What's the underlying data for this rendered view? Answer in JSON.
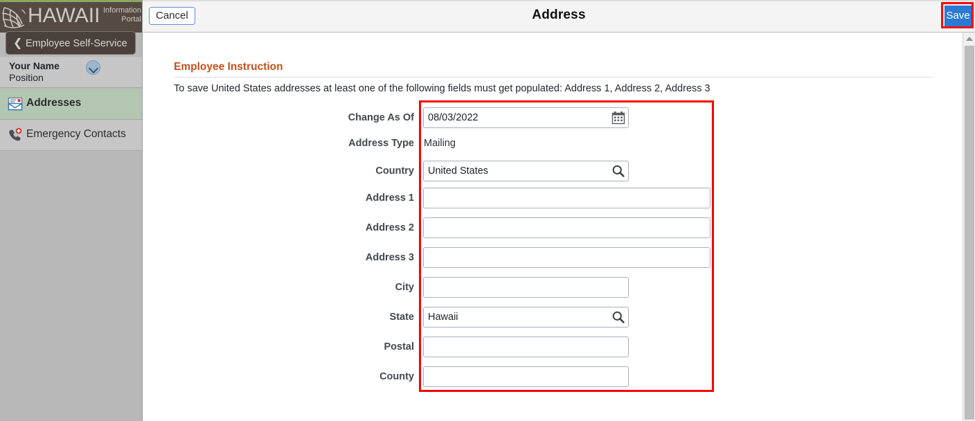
{
  "brand": {
    "name": "HAWAII",
    "sub_line1": "Information",
    "sub_line2": "Portal",
    "logo_icon": "hawaii-net-logo-icon"
  },
  "sidebar": {
    "back_pill": {
      "label": "Employee Self-Service",
      "icon": "chevron-left-icon"
    },
    "user": {
      "name": "Your Name",
      "position": "Position",
      "expand_icon": "chevron-down-circle-icon"
    },
    "items": [
      {
        "label": "Addresses",
        "icon": "address-envelope-icon",
        "selected": true
      },
      {
        "label": "Emergency Contacts",
        "icon": "phone-emergency-icon",
        "selected": false
      }
    ]
  },
  "header": {
    "cancel_label": "Cancel",
    "title": "Address",
    "save_label": "Save",
    "save_highlight_color": "#ff0000",
    "save_button_color": "#2a7ad4"
  },
  "instruction": {
    "heading": "Employee Instruction",
    "heading_color": "#c2521c",
    "text": "To save United States addresses at least one of the following fields must get populated: Address 1, Address 2, Address 3"
  },
  "form": {
    "highlight_color": "#ff0000",
    "fields": [
      {
        "label": "Change As Of",
        "value": "08/03/2022",
        "placeholder": "",
        "type": "input",
        "width": "narrow",
        "adorn": "calendar-icon"
      },
      {
        "label": "Address Type",
        "value": "Mailing",
        "type": "static"
      },
      {
        "label": "Country",
        "value": "United States",
        "placeholder": "",
        "type": "input",
        "width": "narrow",
        "adorn": "search-icon"
      },
      {
        "label": "Address 1",
        "value": "",
        "placeholder": "",
        "type": "input",
        "width": "wide",
        "adorn": ""
      },
      {
        "label": "Address 2",
        "value": "",
        "placeholder": "",
        "type": "input",
        "width": "wide",
        "adorn": ""
      },
      {
        "label": "Address 3",
        "value": "",
        "placeholder": "",
        "type": "input",
        "width": "wide",
        "adorn": ""
      },
      {
        "label": "City",
        "value": "",
        "placeholder": "",
        "type": "input",
        "width": "narrow",
        "adorn": ""
      },
      {
        "label": "State",
        "value": "Hawaii",
        "placeholder": "",
        "type": "input",
        "width": "narrow",
        "adorn": "search-icon"
      },
      {
        "label": "Postal",
        "value": "",
        "placeholder": "",
        "type": "input",
        "width": "narrow",
        "adorn": ""
      },
      {
        "label": "County",
        "value": "",
        "placeholder": "",
        "type": "input",
        "width": "narrow",
        "adorn": ""
      }
    ]
  },
  "scrollbar": {
    "up_arrow_icon": "scroll-up-arrow-icon",
    "thumb": "scroll-thumb"
  }
}
